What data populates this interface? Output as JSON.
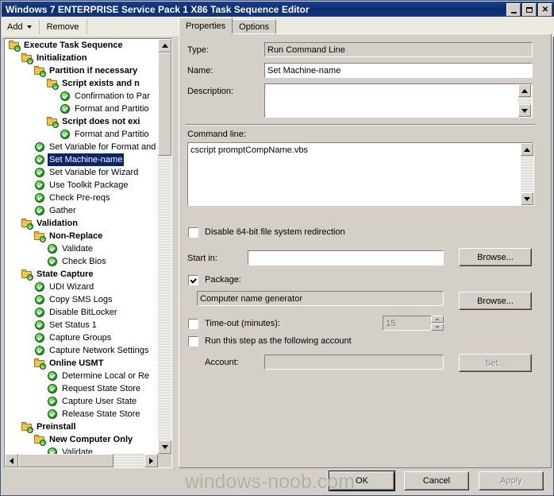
{
  "window": {
    "title": "Windows 7 ENTERPRISE Service Pack 1 X86 Task Sequence Editor",
    "minimize_label": "Minimize",
    "maximize_label": "Maximize",
    "close_label": "Close",
    "titlebar_color": "#0a2d72"
  },
  "toolbar": {
    "add_label": "Add",
    "remove_label": "Remove",
    "move_up_icon": "move-up-icon",
    "move_down_icon": "move-down-icon"
  },
  "tree": {
    "items": [
      {
        "label": "Execute Task Sequence",
        "level": 0,
        "type": "folder",
        "selected": false
      },
      {
        "label": "Initialization",
        "level": 1,
        "type": "folder",
        "selected": false
      },
      {
        "label": "Partition if necessary",
        "level": 2,
        "type": "folder",
        "selected": false
      },
      {
        "label": "Script exists and n",
        "level": 3,
        "type": "folder",
        "selected": false
      },
      {
        "label": "Confirmation to Par",
        "level": 4,
        "type": "step",
        "selected": false
      },
      {
        "label": "Format and Partitio",
        "level": 4,
        "type": "step",
        "selected": false
      },
      {
        "label": "Script does not exi",
        "level": 3,
        "type": "folder",
        "selected": false
      },
      {
        "label": "Format and Partitio",
        "level": 4,
        "type": "step",
        "selected": false
      },
      {
        "label": "Set Variable for Format and",
        "level": 2,
        "type": "step",
        "selected": false
      },
      {
        "label": "Set Machine-name",
        "level": 2,
        "type": "step",
        "selected": true
      },
      {
        "label": "Set Variable for Wizard",
        "level": 2,
        "type": "step",
        "selected": false
      },
      {
        "label": "Use Toolkit Package",
        "level": 2,
        "type": "step",
        "selected": false
      },
      {
        "label": "Check Pre-reqs",
        "level": 2,
        "type": "step",
        "selected": false
      },
      {
        "label": "Gather",
        "level": 2,
        "type": "step",
        "selected": false
      },
      {
        "label": "Validation",
        "level": 1,
        "type": "folder",
        "selected": false
      },
      {
        "label": "Non-Replace",
        "level": 2,
        "type": "folder",
        "selected": false
      },
      {
        "label": "Validate",
        "level": 3,
        "type": "step",
        "selected": false
      },
      {
        "label": "Check Bios",
        "level": 3,
        "type": "step",
        "selected": false
      },
      {
        "label": "State Capture",
        "level": 1,
        "type": "folder",
        "selected": false
      },
      {
        "label": "UDI Wizard",
        "level": 2,
        "type": "step",
        "selected": false
      },
      {
        "label": "Copy SMS Logs",
        "level": 2,
        "type": "step",
        "selected": false
      },
      {
        "label": "Disable BitLocker",
        "level": 2,
        "type": "step",
        "selected": false
      },
      {
        "label": "Set Status 1",
        "level": 2,
        "type": "step",
        "selected": false
      },
      {
        "label": "Capture Groups",
        "level": 2,
        "type": "step",
        "selected": false
      },
      {
        "label": "Capture Network Settings",
        "level": 2,
        "type": "step",
        "selected": false
      },
      {
        "label": "Online USMT",
        "level": 2,
        "type": "folder",
        "selected": false
      },
      {
        "label": "Determine Local or Re",
        "level": 3,
        "type": "step",
        "selected": false
      },
      {
        "label": "Request State Store",
        "level": 3,
        "type": "step",
        "selected": false
      },
      {
        "label": "Capture User State",
        "level": 3,
        "type": "step",
        "selected": false
      },
      {
        "label": "Release State Store",
        "level": 3,
        "type": "step",
        "selected": false
      },
      {
        "label": "Preinstall",
        "level": 1,
        "type": "folder",
        "selected": false
      },
      {
        "label": "New Computer Only",
        "level": 2,
        "type": "folder",
        "selected": false
      },
      {
        "label": "Validate",
        "level": 3,
        "type": "step",
        "selected": false
      }
    ]
  },
  "tabs": [
    {
      "label": "Properties",
      "active": true
    },
    {
      "label": "Options",
      "active": false
    }
  ],
  "properties": {
    "type_label": "Type:",
    "type_value": "Run Command Line",
    "name_label": "Name:",
    "name_value": "Set Machine-name",
    "description_label": "Description:",
    "description_value": "",
    "command_line_label": "Command line:",
    "command_line_value": "cscript promptCompName.vbs",
    "disable_redirection_label": "Disable 64-bit file system redirection",
    "disable_redirection_checked": false,
    "start_in_label": "Start in:",
    "start_in_value": "",
    "start_in_browse_label": "Browse...",
    "package_label": "Package:",
    "package_checked": true,
    "package_value": "Computer name generator",
    "package_browse_label": "Browse...",
    "timeout_label": "Time-out (minutes):",
    "timeout_checked": false,
    "timeout_value": "15",
    "run_as_label": "Run this step as the following account",
    "run_as_checked": false,
    "account_label": "Account:",
    "account_value": "",
    "account_set_label": "Set..."
  },
  "buttons": {
    "ok_label": "OK",
    "cancel_label": "Cancel",
    "apply_label": "Apply"
  },
  "watermark": {
    "text": "windows-noob.com"
  }
}
